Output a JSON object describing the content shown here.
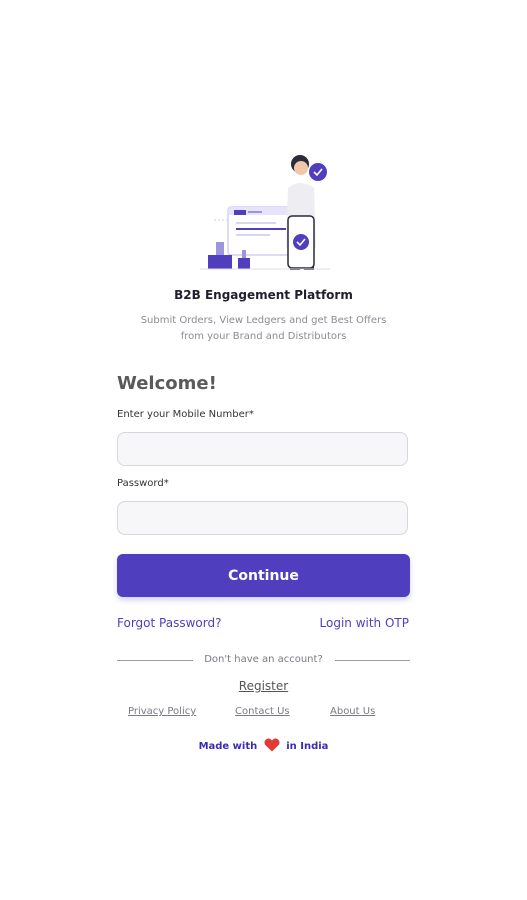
{
  "brand": {
    "title": "B2B Engagement Platform",
    "subtitle_line1": "Submit Orders, View Ledgers and get Best Offers",
    "subtitle_line2": "from your Brand and Distributors"
  },
  "hero": {
    "icon": "person-with-phone-illustration"
  },
  "login": {
    "welcome": "Welcome!",
    "mobile_label": "Enter your Mobile Number*",
    "mobile_value": "",
    "mobile_placeholder": "",
    "password_label": "Password*",
    "password_value": "",
    "password_placeholder": "",
    "continue_label": "Continue",
    "forgot_password": "Forgot Password?",
    "login_with_otp": "Login with OTP"
  },
  "signup": {
    "divider_text": "Don't have an account?",
    "register_label": "Register"
  },
  "footer": {
    "privacy_policy": "Privacy Policy",
    "contact_us": "Contact Us",
    "about_us": "About Us",
    "made_with": "Made with",
    "in_india": "in India",
    "heart_icon": "heart-icon"
  },
  "colors": {
    "accent": "#4f3fbf",
    "heart": "#e53935",
    "text_muted": "#8b8b94"
  }
}
